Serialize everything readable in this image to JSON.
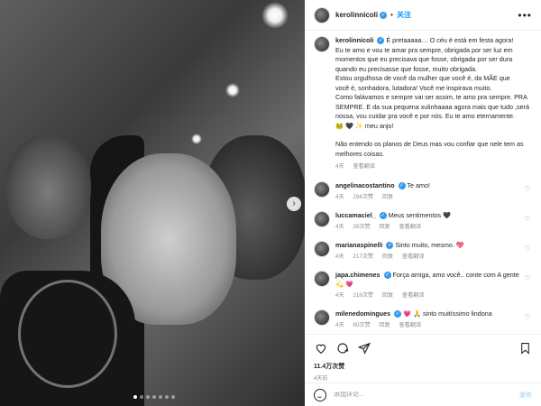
{
  "post": {
    "username": "kerolinnicoli",
    "follow_label": "关注",
    "caption_user": "kerolinnicoli",
    "caption_lines": [
      "É pretaaaaa… O céu é está em festa agora!",
      "Eu te amo e vou te amar pra sempre, obrigada por ser luz em",
      "momentos que eu precisava que fosse, obrigada por ser dura",
      "quando eu precisasse que fosse, muito obrigada.",
      "Estou orgulhosa de você da mulher que você é, da MÃE que",
      "você é, sonhadora, lutadora! Você me inspirava muito.",
      "Como falávamos e sempre vai ser assim, te amo pra sempre. PRA",
      "SEMPRE. E da sua pequena xulinhaaaa agora mais que tudo ,será",
      "nossa, vou cuidar pra você e por nós. Eu te amo eternamente.",
      "🐸 🖤 ✨ meu anjo!",
      "",
      "Não entendo os planos de Deus mas vou confiar que nele tem as",
      "melhores coisas."
    ],
    "caption_time": "4天",
    "caption_translate": "查看翻译"
  },
  "comments": [
    {
      "user": "angelinacostantino",
      "text": "Te amo!",
      "time": "4天",
      "likes": "294次赞",
      "reply": "回复",
      "translate": "",
      "verified": true
    },
    {
      "user": "luccamaciel_",
      "text": "Meus sentimentos 🖤",
      "time": "4天",
      "likes": "26次赞",
      "reply": "回复",
      "translate": "查看翻译",
      "verified": true
    },
    {
      "user": "marianaspinelli",
      "text": "Sinto muito, mesmo. 💖",
      "time": "4天",
      "likes": "217次赞",
      "reply": "回复",
      "translate": "查看翻译",
      "verified": true
    },
    {
      "user": "japa.chimenes",
      "text": "Força amiga, amo você.. conte com A gente",
      "text2": "💫 💗",
      "time": "4天",
      "likes": "218次赞",
      "reply": "回复",
      "translate": "查看翻译",
      "verified": true
    },
    {
      "user": "milenedomingues",
      "text": "💗 🙏 sinto muitíssimo lindona",
      "time": "4天",
      "likes": "80次赞",
      "reply": "回复",
      "translate": "查看翻译",
      "verified": true
    }
  ],
  "actions": {
    "likes": "11.4万次赞",
    "time": "4天前"
  },
  "composer": {
    "placeholder": "添加评论...",
    "post_label": "发布"
  },
  "icons": {
    "like": "heart-icon",
    "comment": "comment-icon",
    "share": "share-icon",
    "save": "bookmark-icon",
    "more": "more-icon",
    "next": "chevron-right-icon",
    "emoji": "emoji-icon"
  },
  "carousel": {
    "count": 7,
    "active": 1
  }
}
